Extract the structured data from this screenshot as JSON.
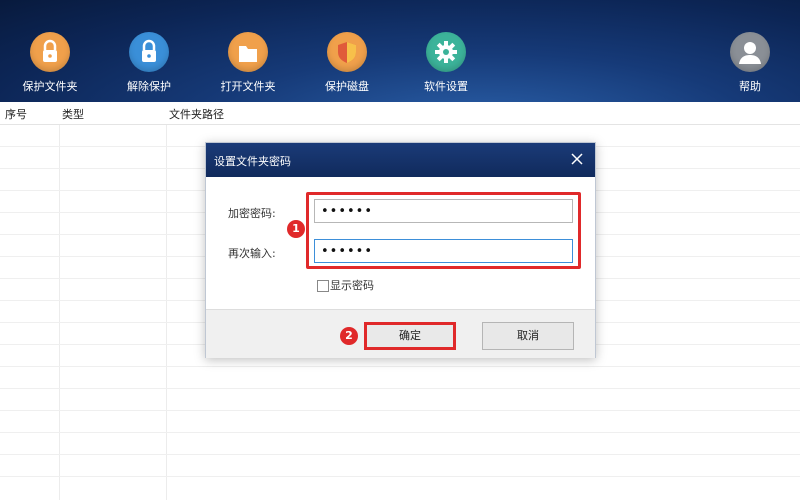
{
  "toolbar": {
    "items": [
      {
        "label": "保护文件夹",
        "icon": "lock-icon",
        "color": "#f0a04b"
      },
      {
        "label": "解除保护",
        "icon": "unlock-icon",
        "color": "#3a8fd8"
      },
      {
        "label": "打开文件夹",
        "icon": "folder-icon",
        "color": "#f0a04b"
      },
      {
        "label": "保护磁盘",
        "icon": "shield-icon",
        "color": "#f0a04b"
      },
      {
        "label": "软件设置",
        "icon": "gear-icon",
        "color": "#3cb39a"
      }
    ],
    "help": {
      "label": "帮助",
      "icon": "user-icon",
      "color": "#8a8f96"
    }
  },
  "table": {
    "columns": [
      "序号",
      "类型",
      "文件夹路径"
    ]
  },
  "dialog": {
    "title": "设置文件夹密码",
    "password_label": "加密密码:",
    "confirm_label": "再次输入:",
    "password_value": "••••••",
    "confirm_value": "••••••",
    "show_password_label": "显示密码",
    "ok_label": "确定",
    "cancel_label": "取消",
    "step1": "1",
    "step2": "2"
  }
}
